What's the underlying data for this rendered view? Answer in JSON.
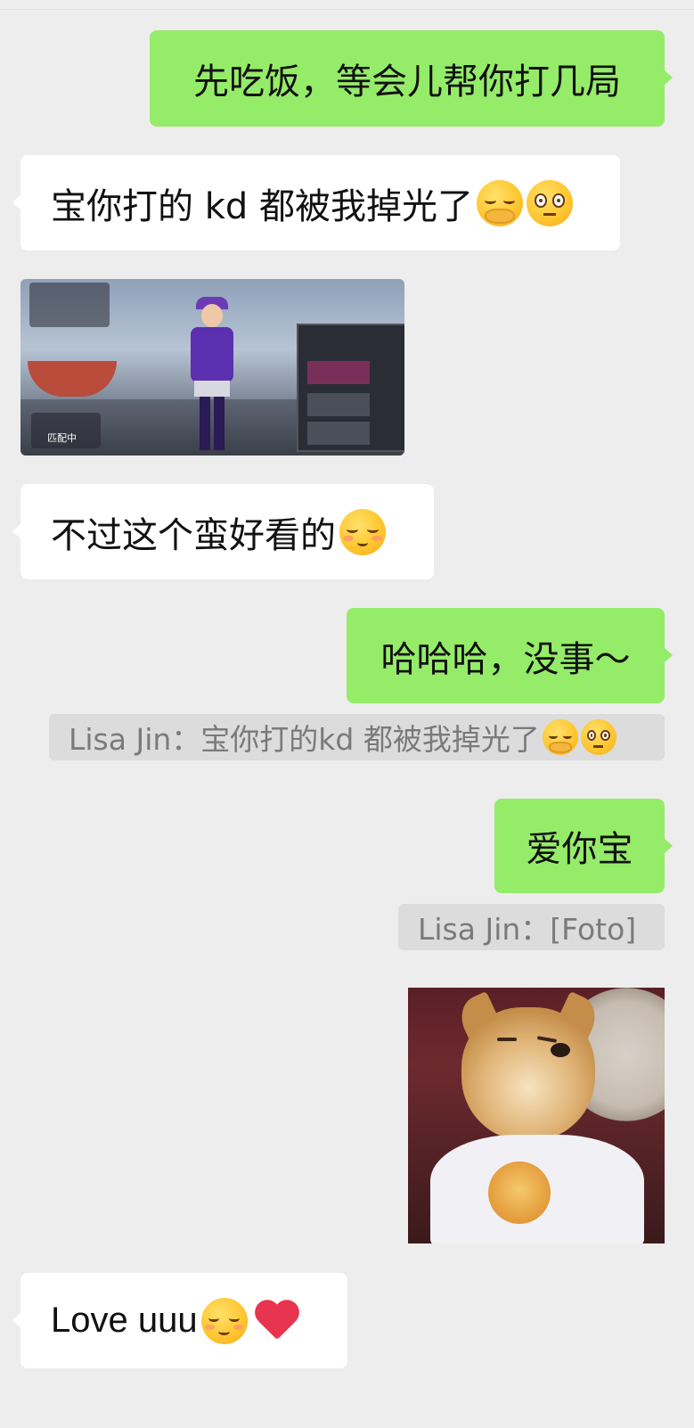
{
  "messages": [
    {
      "id": "m1",
      "side": "out",
      "type": "text",
      "text": "先吃饭，等会儿帮你打几局"
    },
    {
      "id": "m2",
      "side": "in",
      "type": "text",
      "text": "宝你打的 kd 都被我掉光了",
      "emojis": [
        "hand-over-mouth-face-emoji",
        "pleading-face-emoji"
      ]
    },
    {
      "id": "m3",
      "side": "in",
      "type": "image",
      "image": "game-screenshot",
      "image_text": "匹配中"
    },
    {
      "id": "m4",
      "side": "in",
      "type": "text",
      "text": "不过这个蛮好看的",
      "emojis": [
        "blushing-smile-emoji"
      ]
    },
    {
      "id": "m5",
      "side": "out",
      "type": "text",
      "text": "哈哈哈，没事～",
      "quote": "Lisa Jin：宝你打的kd 都被我掉光了",
      "quote_emojis": [
        "hand-over-mouth-face-emoji",
        "pleading-face-emoji"
      ]
    },
    {
      "id": "m6",
      "side": "out",
      "type": "text",
      "text": "爱你宝",
      "quote": "Lisa Jin：[Foto]"
    },
    {
      "id": "m7",
      "side": "out",
      "type": "image",
      "image": "shiba-dog-photo"
    },
    {
      "id": "m8",
      "side": "in",
      "type": "text",
      "text": "Love uuu ",
      "emojis": [
        "blushing-smile-emoji",
        "red-heart-emoji"
      ]
    }
  ],
  "colors": {
    "background": "#ededed",
    "incoming_bubble": "#ffffff",
    "outgoing_bubble": "#95ec69",
    "quote_background": "#dcdcdc",
    "quote_text": "#7a7a7a"
  }
}
